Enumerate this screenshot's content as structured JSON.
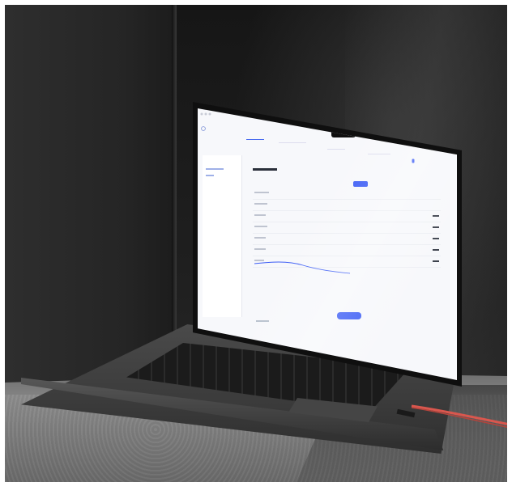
{
  "app": {
    "brand": "",
    "tabs": [],
    "user_name": "",
    "sidebar_heading": "",
    "sidebar_items": [],
    "section_title": "",
    "panel_title": "",
    "toggle_options": [],
    "rows": [],
    "cta_label": "",
    "footer_link": ""
  },
  "colors": {
    "accent": "#3b5cf5",
    "cable": "#d9574e",
    "background": "#1b1b1b"
  }
}
